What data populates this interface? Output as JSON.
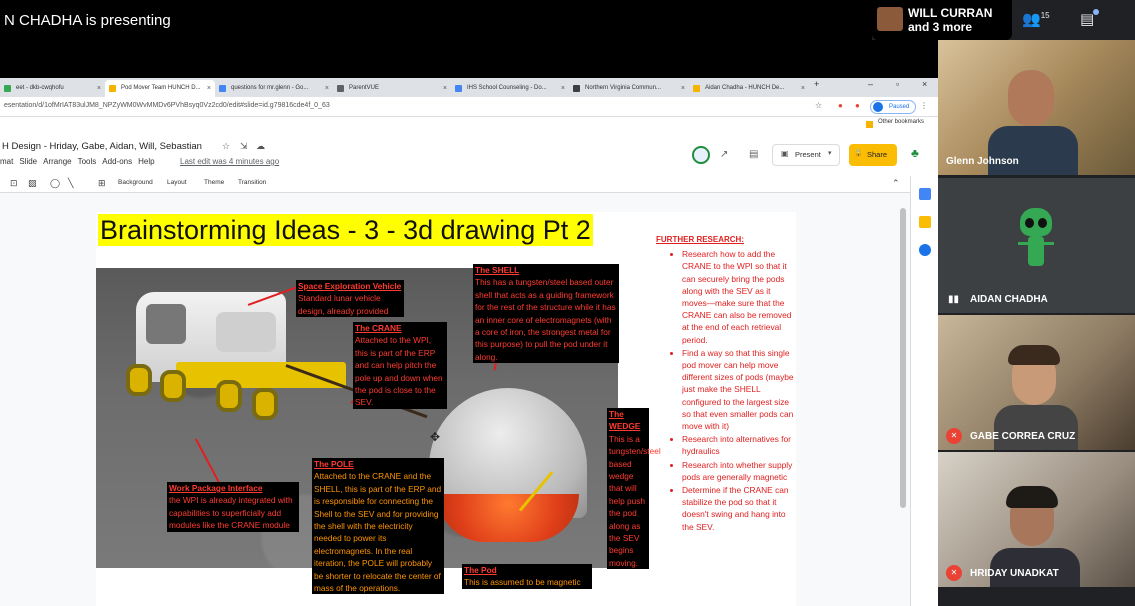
{
  "meet": {
    "presenting_text": "N CHADHA is presenting",
    "speaker_name_1": "WILL CURRAN",
    "speaker_name_2": "and 3 more",
    "participant_count": "15",
    "participants": [
      {
        "name": "Glenn Johnson",
        "mic": "none"
      },
      {
        "name": "AIDAN CHADHA",
        "mic": "on"
      },
      {
        "name": "GABE CORREA CRUZ",
        "mic": "off"
      },
      {
        "name": "HRIDAY UNADKAT",
        "mic": "off"
      }
    ]
  },
  "browser": {
    "tabs": [
      {
        "label": "eet - dkb-cwqhofu",
        "color": "#34a853"
      },
      {
        "label": "Pod Mover Team HUNCH D...",
        "color": "#f4b400"
      },
      {
        "label": "questions for mr.glenn - Go...",
        "color": "#4285f4"
      },
      {
        "label": "ParentVUE",
        "color": "#5f6368"
      },
      {
        "label": "IHS School Counseling - Do...",
        "color": "#4285f4"
      },
      {
        "label": "Northern Virginia Commun...",
        "color": "#3c4043"
      },
      {
        "label": "Aidan Chadha - HUNCH De...",
        "color": "#f4b400"
      }
    ],
    "url": "esentation/d/1ofMrIAT83ulJM8_NPZyWM0WvMMDv6PVhBsyq0Vz2cd0/edit#slide=id.g79816cde4f_0_63",
    "paused_label": "Paused",
    "other_bookmarks": "Other bookmarks"
  },
  "slides": {
    "doc_title": "H Design - Hriday, Gabe, Aidan, Will, Sebastian",
    "menus": [
      "mat",
      "Slide",
      "Arrange",
      "Tools",
      "Add-ons",
      "Help"
    ],
    "last_edit": "Last edit was 4 minutes ago",
    "present_label": "Present",
    "share_label": "Share",
    "toolbar": [
      "Background",
      "Layout",
      "Theme",
      "Transition"
    ]
  },
  "slide": {
    "title": "Brainstorming Ideas - 3 - 3d drawing Pt 2",
    "labels": {
      "sev_h": "Space Exploration Vehicle",
      "sev_b": "Standard lunar vehicle design, already provided",
      "crane_h": "The CRANE",
      "crane_b": "Attached to the WPI, this is part of the ERP and can help pitch the pole up and down when the pod is close to the SEV.",
      "shell_h": "The SHELL",
      "shell_b": "This has a tungsten/steel based outer shell that acts as a guiding framework for the rest of the structure while it has an inner core of electromagnets (with a core of iron, the strongest metal for this purpose) to pull the pod under it along.",
      "wedge_h": "The WEDGE",
      "wedge_b": "This is a tungsten/steel based wedge that will help push the pod along as the SEV begins moving.",
      "pole_h": "The POLE",
      "pole_b": "Attached to the CRANE and the SHELL, this is part of the ERP and is responsible for connecting the Shell to the SEV and for providing the shell with the electricity needed to power its electromagnets. In the real iteration, the POLE will probably be shorter to relocate the center of mass of the operations.",
      "wpi_h": "Work Package Interface",
      "wpi_b": "the WPI is already integrated with capabilities to superficially add modules like the CRANE module",
      "pod_h": "The Pod",
      "pod_b": "This is assumed to be magnetic"
    },
    "research_heading": "FURTHER RESEARCH:",
    "research_items": [
      "Research how to add the CRANE to the WPI so that it can securely bring the pods along with the SEV as it moves—make sure that the CRANE can also be removed at the end of each retrieval period.",
      " Find a way so that this single pod mover can help move different sizes of pods (maybe just make the SHELL configured to the largest size so that even smaller pods can move with it)",
      "Research into alternatives for hydraulics",
      "Research into whether supply pods are generally magnetic",
      "Determine if the CRANE can stabilize the pod so that it doesn't swing and hang into the SEV."
    ]
  }
}
